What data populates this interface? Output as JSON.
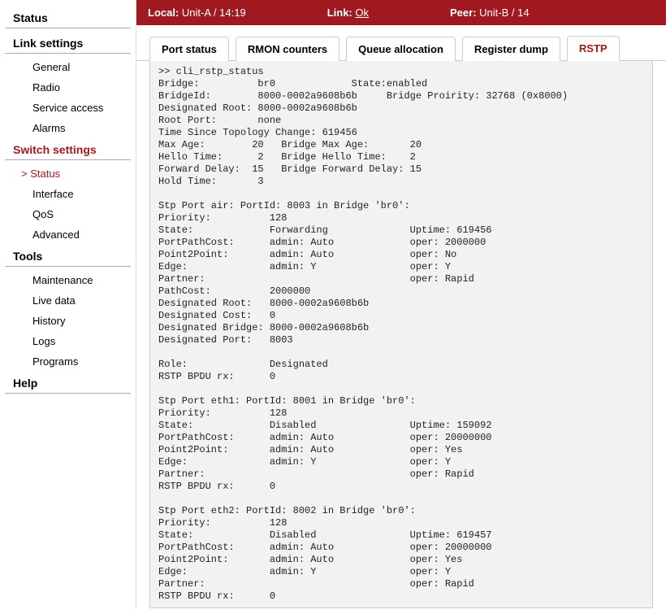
{
  "topbar": {
    "local_label": "Local:",
    "local_value": "Unit-A / 14:19",
    "link_label": "Link:",
    "link_value": "Ok",
    "peer_label": "Peer:",
    "peer_value": "Unit-B / 14"
  },
  "sidebar": {
    "groups": [
      {
        "title": "Status",
        "items": []
      },
      {
        "title": "Link settings",
        "items": [
          {
            "label": "General",
            "active": false
          },
          {
            "label": "Radio",
            "active": false
          },
          {
            "label": "Service access",
            "active": false
          },
          {
            "label": "Alarms",
            "active": false
          }
        ]
      },
      {
        "title": "Switch settings",
        "items": [
          {
            "label": "Status",
            "active": true
          },
          {
            "label": "Interface",
            "active": false
          },
          {
            "label": "QoS",
            "active": false
          },
          {
            "label": "Advanced",
            "active": false
          }
        ]
      },
      {
        "title": "Tools",
        "items": [
          {
            "label": "Maintenance",
            "active": false
          },
          {
            "label": "Live data",
            "active": false
          },
          {
            "label": "History",
            "active": false
          },
          {
            "label": "Logs",
            "active": false
          },
          {
            "label": "Programs",
            "active": false
          }
        ]
      },
      {
        "title": "Help",
        "items": []
      }
    ]
  },
  "tabs": [
    {
      "label": "Port status",
      "active": false
    },
    {
      "label": "RMON counters",
      "active": false
    },
    {
      "label": "Queue allocation",
      "active": false
    },
    {
      "label": "Register dump",
      "active": false
    },
    {
      "label": "RSTP",
      "active": true
    }
  ],
  "console_text": ">> cli_rstp_status\nBridge:          br0             State:enabled\nBridgeId:        8000-0002a9608b6b     Bridge Proirity: 32768 (0x8000)\nDesignated Root: 8000-0002a9608b6b\nRoot Port:       none\nTime Since Topology Change: 619456\nMax Age:        20   Bridge Max Age:       20\nHello Time:      2   Bridge Hello Time:    2\nForward Delay:  15   Bridge Forward Delay: 15\nHold Time:       3\n\nStp Port air: PortId: 8003 in Bridge 'br0':\nPriority:          128\nState:             Forwarding              Uptime: 619456\nPortPathCost:      admin: Auto             oper: 2000000\nPoint2Point:       admin: Auto             oper: No\nEdge:              admin: Y                oper: Y\nPartner:                                   oper: Rapid\nPathCost:          2000000\nDesignated Root:   8000-0002a9608b6b\nDesignated Cost:   0\nDesignated Bridge: 8000-0002a9608b6b\nDesignated Port:   8003\n\nRole:              Designated\nRSTP BPDU rx:      0\n\nStp Port eth1: PortId: 8001 in Bridge 'br0':\nPriority:          128\nState:             Disabled                Uptime: 159092\nPortPathCost:      admin: Auto             oper: 20000000\nPoint2Point:       admin: Auto             oper: Yes\nEdge:              admin: Y                oper: Y\nPartner:                                   oper: Rapid\nRSTP BPDU rx:      0\n\nStp Port eth2: PortId: 8002 in Bridge 'br0':\nPriority:          128\nState:             Disabled                Uptime: 619457\nPortPathCost:      admin: Auto             oper: 20000000\nPoint2Point:       admin: Auto             oper: Yes\nEdge:              admin: Y                oper: Y\nPartner:                                   oper: Rapid\nRSTP BPDU rx:      0"
}
